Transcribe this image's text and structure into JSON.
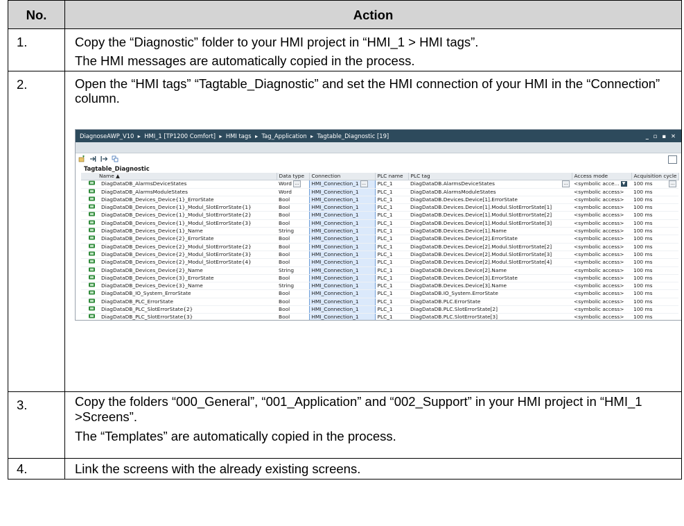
{
  "header": {
    "no": "No.",
    "action": "Action"
  },
  "steps": [
    {
      "no": "1.",
      "lines": [
        "Copy the “Diagnostic” folder to your HMI project in “HMI_1 > HMI tags”.",
        "The HMI messages are automatically copied in the process."
      ]
    },
    {
      "no": "2.",
      "lines": [
        "Open the “HMI tags” “Tagtable_Diagnostic” and set the HMI connection of your HMI in the “Connection” column."
      ]
    },
    {
      "no": "3.",
      "lines": [
        "Copy the folders “000_General”, “001_Application” and “002_Support” in your HMI project in “HMI_1 >Screens”.",
        "The “Templates” are automatically copied in the process."
      ]
    },
    {
      "no": "4.",
      "lines": [
        "Link the screens with the already existing screens."
      ]
    }
  ],
  "screenshot": {
    "breadcrumbs": [
      "DiagnoseAWP_V10",
      "HMI_1 [TP1200 Comfort]",
      "HMI tags",
      "Tag_Application",
      "Tagtable_Diagnostic [19]"
    ],
    "window_buttons": "_ ▫ ▪ ✕",
    "table_name": "Tagtable_Diagnostic",
    "columns": [
      "Name ▲",
      "Data type",
      "Connection",
      "PLC name",
      "PLC tag",
      "Access mode",
      "Acquisition cycle"
    ],
    "rows": [
      [
        "DiagDataDB_AlarmsDeviceStates",
        "Word",
        "HMI_Connection_1",
        "PLC_1",
        "DiagDataDB.AlarmsDeviceStates",
        "<symbolic acce...",
        "100 ms"
      ],
      [
        "DiagDataDB_AlarmsModuleStates",
        "Word",
        "HMI_Connection_1",
        "PLC_1",
        "DiagDataDB.AlarmsModuleStates",
        "<symbolic access>",
        "100 ms"
      ],
      [
        "DiagDataDB_Devices_Device{1}_ErrorState",
        "Bool",
        "HMI_Connection_1",
        "PLC_1",
        "DiagDataDB.Devices.Device[1].ErrorState",
        "<symbolic access>",
        "100 ms"
      ],
      [
        "DiagDataDB_Devices_Device{1}_Modul_SlotErrorState{1}",
        "Bool",
        "HMI_Connection_1",
        "PLC_1",
        "DiagDataDB.Devices.Device[1].Modul.SlotErrorState[1]",
        "<symbolic access>",
        "100 ms"
      ],
      [
        "DiagDataDB_Devices_Device{1}_Modul_SlotErrorState{2}",
        "Bool",
        "HMI_Connection_1",
        "PLC_1",
        "DiagDataDB.Devices.Device[1].Modul.SlotErrorState[2]",
        "<symbolic access>",
        "100 ms"
      ],
      [
        "DiagDataDB_Devices_Device{1}_Modul_SlotErrorState{3}",
        "Bool",
        "HMI_Connection_1",
        "PLC_1",
        "DiagDataDB.Devices.Device[1].Modul.SlotErrorState[3]",
        "<symbolic access>",
        "100 ms"
      ],
      [
        "DiagDataDB_Devices_Device{1}_Name",
        "String",
        "HMI_Connection_1",
        "PLC_1",
        "DiagDataDB.Devices.Device[1].Name",
        "<symbolic access>",
        "100 ms"
      ],
      [
        "DiagDataDB_Devices_Device{2}_ErrorState",
        "Bool",
        "HMI_Connection_1",
        "PLC_1",
        "DiagDataDB.Devices.Device[2].ErrorState",
        "<symbolic access>",
        "100 ms"
      ],
      [
        "DiagDataDB_Devices_Device{2}_Modul_SlotErrorState{2}",
        "Bool",
        "HMI_Connection_1",
        "PLC_1",
        "DiagDataDB.Devices.Device[2].Modul.SlotErrorState[2]",
        "<symbolic access>",
        "100 ms"
      ],
      [
        "DiagDataDB_Devices_Device{2}_Modul_SlotErrorState{3}",
        "Bool",
        "HMI_Connection_1",
        "PLC_1",
        "DiagDataDB.Devices.Device[2].Modul.SlotErrorState[3]",
        "<symbolic access>",
        "100 ms"
      ],
      [
        "DiagDataDB_Devices_Device{2}_Modul_SlotErrorState{4}",
        "Bool",
        "HMI_Connection_1",
        "PLC_1",
        "DiagDataDB.Devices.Device[2].Modul.SlotErrorState[4]",
        "<symbolic access>",
        "100 ms"
      ],
      [
        "DiagDataDB_Devices_Device{2}_Name",
        "String",
        "HMI_Connection_1",
        "PLC_1",
        "DiagDataDB.Devices.Device[2].Name",
        "<symbolic access>",
        "100 ms"
      ],
      [
        "DiagDataDB_Devices_Device{3}_ErrorState",
        "Bool",
        "HMI_Connection_1",
        "PLC_1",
        "DiagDataDB.Devices.Device[3].ErrorState",
        "<symbolic access>",
        "100 ms"
      ],
      [
        "DiagDataDB_Devices_Device{3}_Name",
        "String",
        "HMI_Connection_1",
        "PLC_1",
        "DiagDataDB.Devices.Device[3].Name",
        "<symbolic access>",
        "100 ms"
      ],
      [
        "DiagDataDB_IO_System_ErrorState",
        "Bool",
        "HMI_Connection_1",
        "PLC_1",
        "DiagDataDB.IO_System.ErrorState",
        "<symbolic access>",
        "100 ms"
      ],
      [
        "DiagDataDB_PLC_ErrorState",
        "Bool",
        "HMI_Connection_1",
        "PLC_1",
        "DiagDataDB.PLC.ErrorState",
        "<symbolic access>",
        "100 ms"
      ],
      [
        "DiagDataDB_PLC_SlotErrorState{2}",
        "Bool",
        "HMI_Connection_1",
        "PLC_1",
        "DiagDataDB.PLC.SlotErrorState[2]",
        "<symbolic access>",
        "100 ms"
      ],
      [
        "DiagDataDB_PLC_SlotErrorState{3}",
        "Bool",
        "HMI_Connection_1",
        "PLC_1",
        "DiagDataDB.PLC.SlotErrorState[3]",
        "<symbolic access>",
        "100 ms"
      ],
      [
        "DiagDataDB_PLC_SlotErrorState{4}",
        "Bool",
        "HMI_Connection_1",
        "PLC_1",
        "DiagDataDB.PLC.SlotErrorState[4]",
        "<symbolic access>",
        "100 ms"
      ]
    ]
  },
  "colors": {
    "header_bg": "#d4d4d4",
    "titlebar": "#2d4a5c",
    "selection": "#dbe9fb",
    "tag_icon": "#2f8a3a"
  }
}
